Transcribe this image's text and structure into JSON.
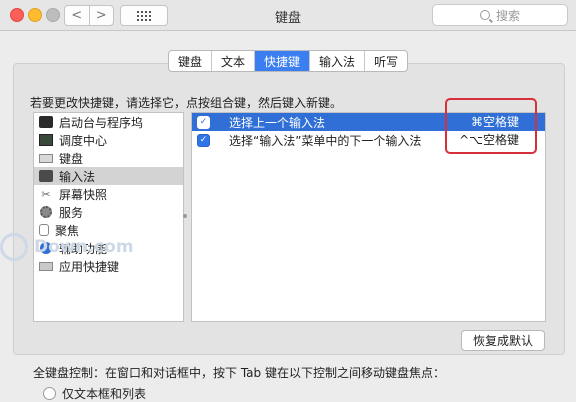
{
  "window": {
    "title": "键盘",
    "search_placeholder": "搜索",
    "nav_back": "<",
    "nav_forward": ">"
  },
  "tabs": [
    {
      "label": "键盘",
      "active": false
    },
    {
      "label": "文本",
      "active": false
    },
    {
      "label": "快捷键",
      "active": true
    },
    {
      "label": "输入法",
      "active": false
    },
    {
      "label": "听写",
      "active": false
    }
  ],
  "hint": "若要更改快捷键，请选择它，点按组合键，然后键入新键。",
  "categories": [
    {
      "label": "启动台与程序坞",
      "icon": "dock-icon",
      "selected": false
    },
    {
      "label": "调度中心",
      "icon": "mission-control-icon",
      "selected": false
    },
    {
      "label": "键盘",
      "icon": "keyboard-icon",
      "selected": false
    },
    {
      "label": "输入法",
      "icon": "input-method-icon",
      "selected": true
    },
    {
      "label": "屏幕快照",
      "icon": "screenshot-icon",
      "selected": false
    },
    {
      "label": "服务",
      "icon": "services-icon",
      "selected": false
    },
    {
      "label": "聚焦",
      "icon": "spotlight-icon",
      "selected": false
    },
    {
      "label": "辅助功能",
      "icon": "accessibility-icon",
      "selected": false
    },
    {
      "label": "应用快捷键",
      "icon": "app-shortcuts-icon",
      "selected": false
    }
  ],
  "shortcuts": [
    {
      "label": "选择上一个输入法",
      "keys": "⌘空格键",
      "checked": true,
      "selected": true
    },
    {
      "label": "选择“输入法”菜单中的下一个输入法",
      "keys": "^⌥空格键",
      "checked": true,
      "selected": false
    }
  ],
  "restore_button": "恢复成默认",
  "full_keyboard_label": "全键盘控制：在窗口和对话框中，按下 Tab 键在以下控制之间移动键盘焦点：",
  "radio_option": "仅文本框和列表",
  "watermark": "Down.com",
  "colors": {
    "accent": "#2f6fd6",
    "highlight_box": "#d7303a"
  }
}
